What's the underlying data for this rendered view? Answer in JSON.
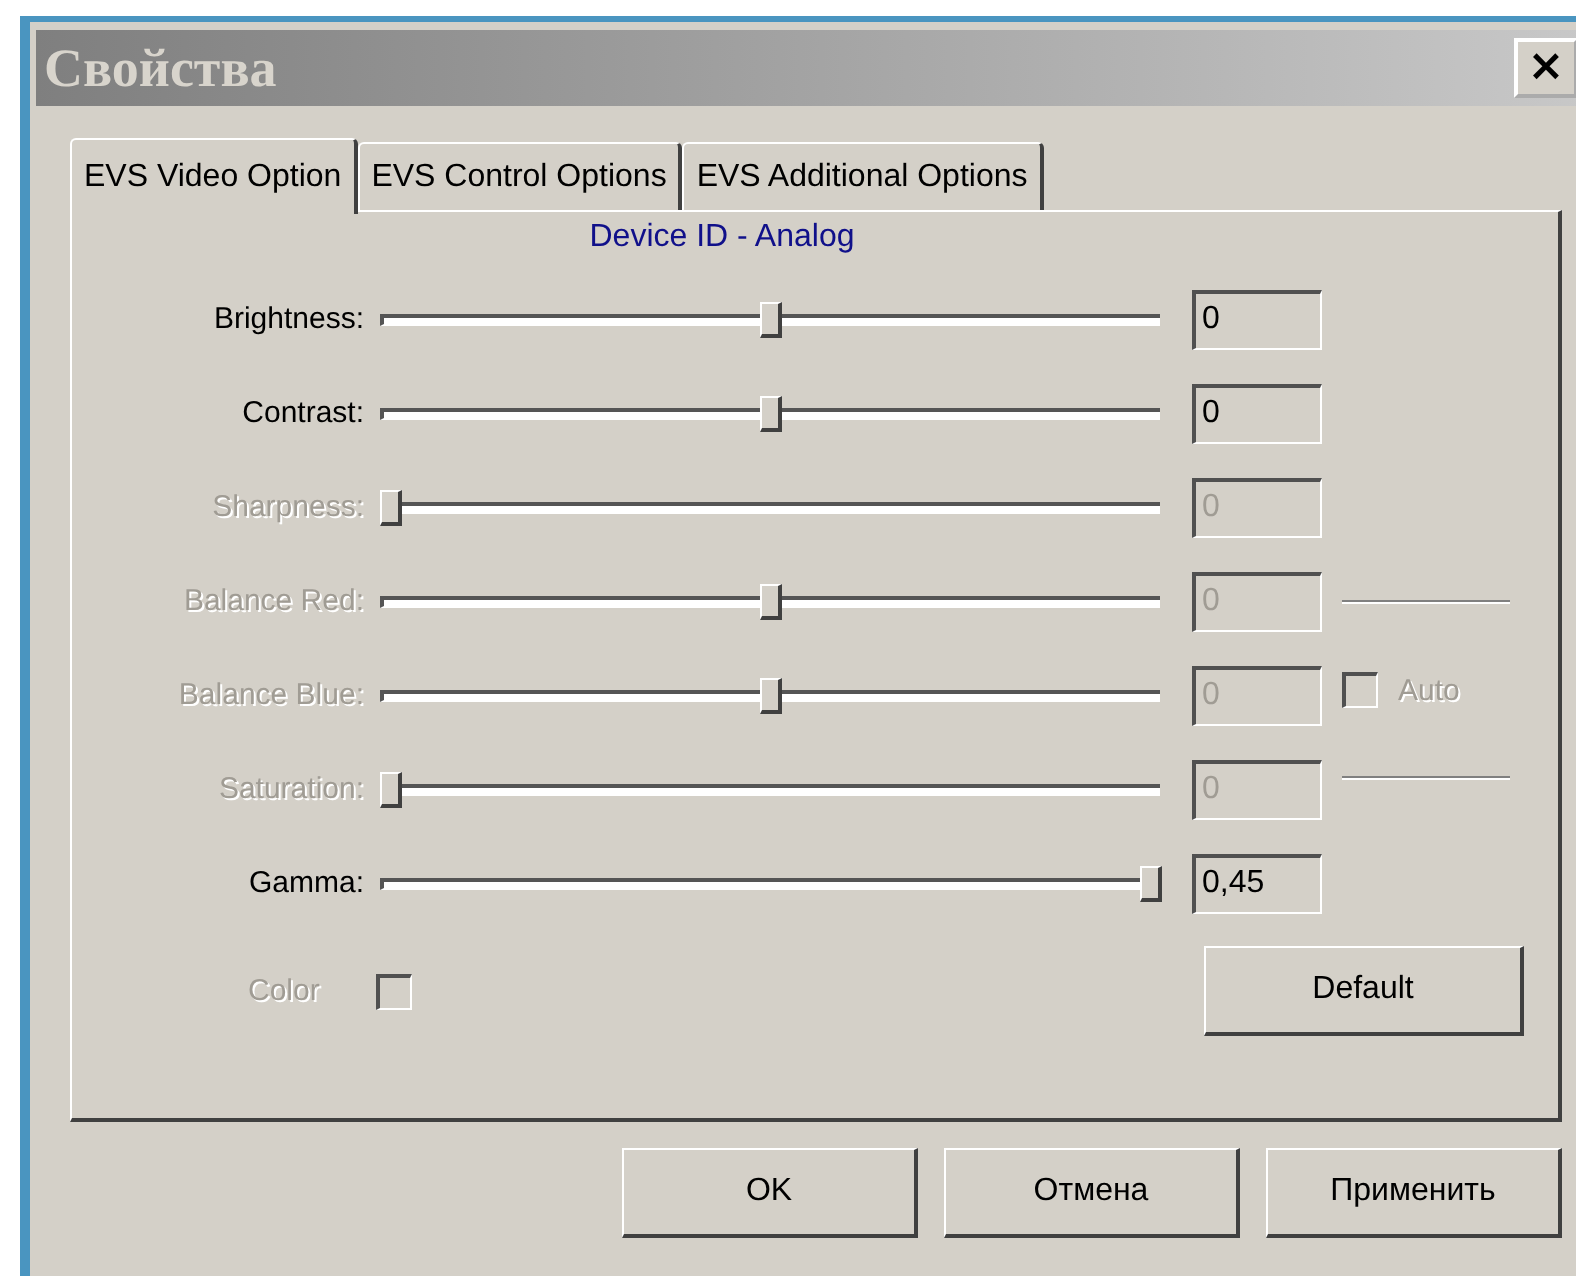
{
  "window": {
    "title": "Свойства",
    "close": "×"
  },
  "tabs": [
    {
      "label": "EVS Video Option",
      "selected": true
    },
    {
      "label": "EVS Control Options",
      "selected": false
    },
    {
      "label": "EVS Additional Options",
      "selected": false
    }
  ],
  "device": "Device ID - Analog",
  "sliders": [
    {
      "label": "Brightness:",
      "level": 0.5,
      "value": "0",
      "disabled": false
    },
    {
      "label": "Contrast:",
      "level": 0.5,
      "value": "0",
      "disabled": false
    },
    {
      "label": "Sharpness:",
      "level": 0,
      "value": "0",
      "disabled": true
    },
    {
      "label": "Balance Red:",
      "level": 0.5,
      "value": "0",
      "disabled": true
    },
    {
      "label": "Balance Blue:",
      "level": 0.5,
      "value": "0",
      "disabled": true
    },
    {
      "label": "Saturation:",
      "level": 0,
      "value": "0",
      "disabled": true
    },
    {
      "label": "Gamma:",
      "level": 1,
      "value": "0,45",
      "disabled": false
    }
  ],
  "auto": {
    "label": "Auto",
    "checked": false,
    "disabled": true
  },
  "color": {
    "label": "Color",
    "checked": false,
    "disabled": true
  },
  "default_button": "Default",
  "buttons": [
    "OK",
    "Отмена",
    "Применить"
  ]
}
